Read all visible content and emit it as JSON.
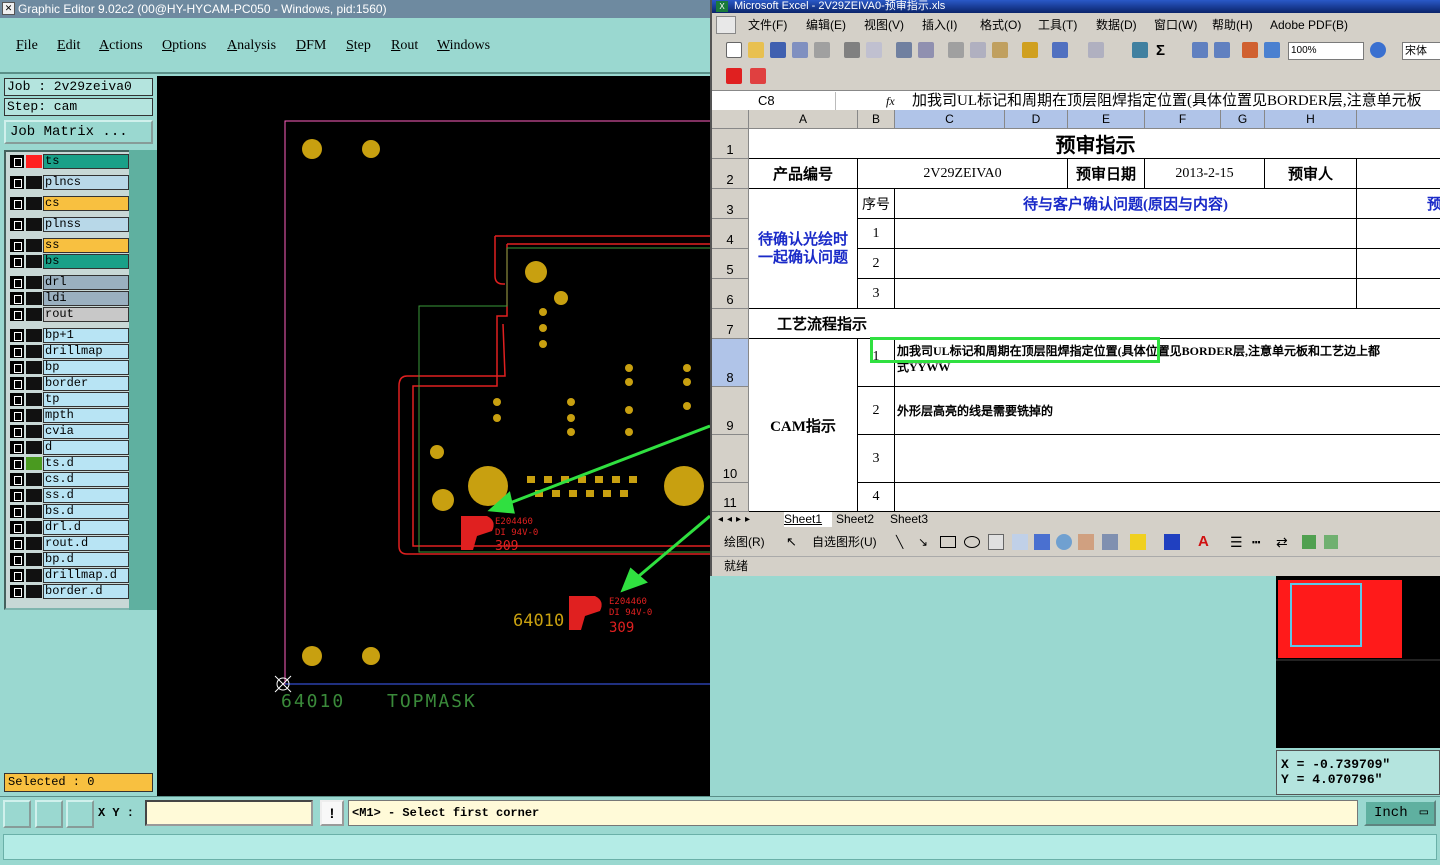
{
  "genesis": {
    "title": "Graphic Editor 9.02c2 (00@HY-HYCAM-PC050 - Windows, pid:1560)",
    "menus": [
      "File",
      "Edit",
      "Actions",
      "Options",
      "Analysis",
      "DFM",
      "Step",
      "Rout",
      "Windows"
    ],
    "job_label": "Job : 2v29zeiva0",
    "step_label": "Step: cam",
    "job_matrix_button": "Job Matrix ...",
    "layers": [
      {
        "name": "ts",
        "color": "#1aa088",
        "swatch": "#ff2020"
      },
      {
        "name": "plncs",
        "color": "#b8d8e8",
        "swatch": "#111111"
      },
      {
        "name": "cs",
        "color": "#f8c040",
        "swatch": "#111111"
      },
      {
        "name": "plnss",
        "color": "#b8d8e8",
        "swatch": "#111111"
      },
      {
        "name": "ss",
        "color": "#f8c040",
        "swatch": "#111111"
      },
      {
        "name": "bs",
        "color": "#1aa088",
        "swatch": "#111111"
      },
      {
        "name": "drl",
        "color": "#9ab0c0",
        "swatch": "#111111"
      },
      {
        "name": "ldi",
        "color": "#9ab0c0",
        "swatch": "#111111"
      },
      {
        "name": "rout",
        "color": "#c8c8c8",
        "swatch": "#111111"
      },
      {
        "name": "bp+1",
        "color": "#b8e4f4",
        "swatch": "#111111"
      },
      {
        "name": "drillmap",
        "color": "#b8e4f4",
        "swatch": "#111111"
      },
      {
        "name": "bp",
        "color": "#b8e4f4",
        "swatch": "#111111"
      },
      {
        "name": "border",
        "color": "#b8e4f4",
        "swatch": "#111111"
      },
      {
        "name": "tp",
        "color": "#b8e4f4",
        "swatch": "#111111"
      },
      {
        "name": "mpth",
        "color": "#b8e4f4",
        "swatch": "#111111"
      },
      {
        "name": "cvia",
        "color": "#b8e4f4",
        "swatch": "#111111"
      },
      {
        "name": "d",
        "color": "#b8e4f4",
        "swatch": "#111111"
      },
      {
        "name": "ts.d",
        "color": "#b8e4f4",
        "swatch": "#4a9a20"
      },
      {
        "name": "cs.d",
        "color": "#b8e4f4",
        "swatch": "#111111"
      },
      {
        "name": "ss.d",
        "color": "#b8e4f4",
        "swatch": "#111111"
      },
      {
        "name": "bs.d",
        "color": "#b8e4f4",
        "swatch": "#111111"
      },
      {
        "name": "drl.d",
        "color": "#b8e4f4",
        "swatch": "#111111"
      },
      {
        "name": "rout.d",
        "color": "#b8e4f4",
        "swatch": "#111111"
      },
      {
        "name": "bp.d",
        "color": "#b8e4f4",
        "swatch": "#111111"
      },
      {
        "name": "drillmap.d",
        "color": "#b8e4f4",
        "swatch": "#111111"
      },
      {
        "name": "border.d",
        "color": "#b8e4f4",
        "swatch": "#111111"
      }
    ],
    "selected": "Selected : 0",
    "canvas_labels": {
      "board_code": "64010",
      "board_code2": "64010",
      "layer_caption": "TOPMASK",
      "ul_text1": "E204460",
      "ul_text2": "DI 94V-0",
      "ul_text3": "309"
    },
    "xy_label": "X Y :",
    "xy_value": "",
    "message": "<M1> - Select first corner",
    "warn_icon": "!",
    "unit": "Inch",
    "coords": {
      "x": "X  =  -0.739709\"",
      "y": "Y  =  4.070796\""
    }
  },
  "excel": {
    "title": "Microsoft Excel - 2V29ZEIVA0-预审指示.xls",
    "menus": [
      "文件(F)",
      "编辑(E)",
      "视图(V)",
      "插入(I)",
      "格式(O)",
      "工具(T)",
      "数据(D)",
      "窗口(W)",
      "帮助(H)",
      "Adobe PDF(B)"
    ],
    "zoom": "100%",
    "font": "宋体",
    "name_box": "C8",
    "fx": "fx",
    "formula": "加我司UL标记和周期在顶层阻焊指定位置(具体位置见BORDER层,注意单元板",
    "columns": [
      "A",
      "B",
      "C",
      "D",
      "E",
      "F",
      "G",
      "H"
    ],
    "rows": [
      "1",
      "2",
      "3",
      "4",
      "5",
      "6",
      "7",
      "8",
      "9",
      "10",
      "11"
    ],
    "cells": {
      "title": "预审指示",
      "product_label": "产品编号",
      "product_value": "2V29ZEIVA0",
      "date_label": "预审日期",
      "date_value": "2013-2-15",
      "reviewer_label": "预审人",
      "confirm_label": "待确认光绘时一起确认问题",
      "seq_label": "序号",
      "issue_header": "待与客户确认问题(原因与内容)",
      "pre_header": "预",
      "n1": "1",
      "n2": "2",
      "n3": "3",
      "process_label": "工艺流程指示",
      "cam_label": "CAM指示",
      "c8_seq": "1",
      "c8_text": "加我司UL标记和周期在顶层阻焊指定位置(具体位置见BORDER层,注意单元板和工艺边上都",
      "c8_text2": "式YYWW",
      "c9_seq": "2",
      "c9_text": "外形层高亮的线是需要铣掉的",
      "c10_seq": "3",
      "c11_seq": "4"
    },
    "sheets": [
      "Sheet1",
      "Sheet2",
      "Sheet3"
    ],
    "draw_label": "绘图(R)",
    "autoshape_label": "自选图形(U)",
    "status": "就绪"
  }
}
